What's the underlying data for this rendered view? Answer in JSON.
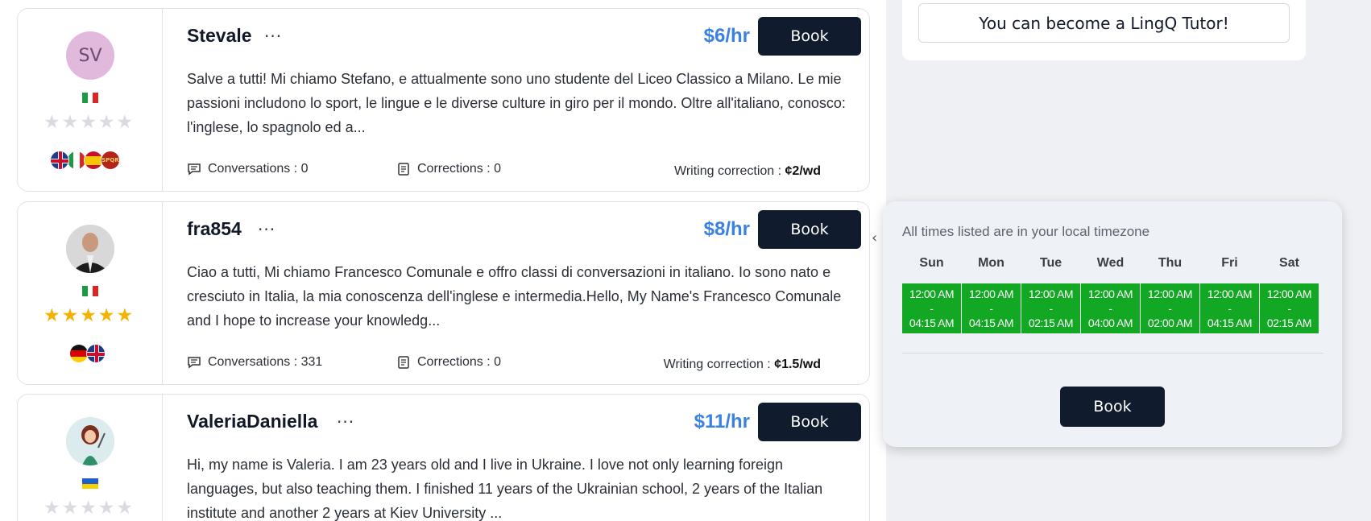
{
  "sidebar": {
    "become_tutor_label": "You can become a LingQ Tutor!"
  },
  "tutors": [
    {
      "name": "Stevale",
      "avatar_initials": "SV",
      "price": "$6/hr",
      "book_label": "Book",
      "rating_stars": 0,
      "bio": "Salve a tutti! Mi chiamo Stefano, e attualmente sono uno studente del Liceo Classico a Milano. Le mie passioni includono lo sport, le lingue e le diverse culture in giro per il mondo. Oltre all'italiano, conosco: l'inglese, lo spagnolo ed a...",
      "conversations": "Conversations : 0",
      "corrections": "Corrections : 0",
      "writing_label": "Writing correction : ",
      "writing_price": "¢2/wd"
    },
    {
      "name": "fra854",
      "price": "$8/hr",
      "book_label": "Book",
      "rating_stars": 5,
      "bio": "Ciao a tutti, Mi chiamo Francesco Comunale e offro classi di conversazioni in italiano. Io sono nato e cresciuto in Italia, la mia conoscenza dell'inglese e intermedia.Hello, My Name's Francesco Comunale and I hope to increase your knowledg...",
      "conversations": "Conversations : 331",
      "corrections": "Corrections : 0",
      "writing_label": "Writing correction : ",
      "writing_price": "¢1.5/wd"
    },
    {
      "name": "ValeriaDaniella",
      "price": "$11/hr",
      "book_label": "Book",
      "rating_stars": 0,
      "bio": "Hi, my name is Valeria. I am 23 years old and I live in Ukraine. I love not only learning foreign languages, but also teaching them. I finished 11 years of the Ukrainian school, 2 years of the Italian institute and another 2 years at Kiev University ..."
    }
  ],
  "schedule": {
    "timezone_note": "All times listed are in your local timezone",
    "days": [
      {
        "name": "Sun",
        "start": "12:00 AM",
        "dash": "-",
        "end": "04:15 AM"
      },
      {
        "name": "Mon",
        "start": "12:00 AM",
        "dash": "-",
        "end": "04:15 AM"
      },
      {
        "name": "Tue",
        "start": "12:00 AM",
        "dash": "-",
        "end": "02:15 AM"
      },
      {
        "name": "Wed",
        "start": "12:00 AM",
        "dash": "-",
        "end": "04:00 AM"
      },
      {
        "name": "Thu",
        "start": "12:00 AM",
        "dash": "-",
        "end": "02:00 AM"
      },
      {
        "name": "Fri",
        "start": "12:00 AM",
        "dash": "-",
        "end": "04:15 AM"
      },
      {
        "name": "Sat",
        "start": "12:00 AM",
        "dash": "-",
        "end": "02:15 AM"
      }
    ],
    "book_label": "Book"
  },
  "colors": {
    "price": "#3b82e0",
    "book_button": "#101c2e",
    "slot_green": "#13a823",
    "star_on": "#f5b301",
    "star_off": "#d9dbe0"
  }
}
